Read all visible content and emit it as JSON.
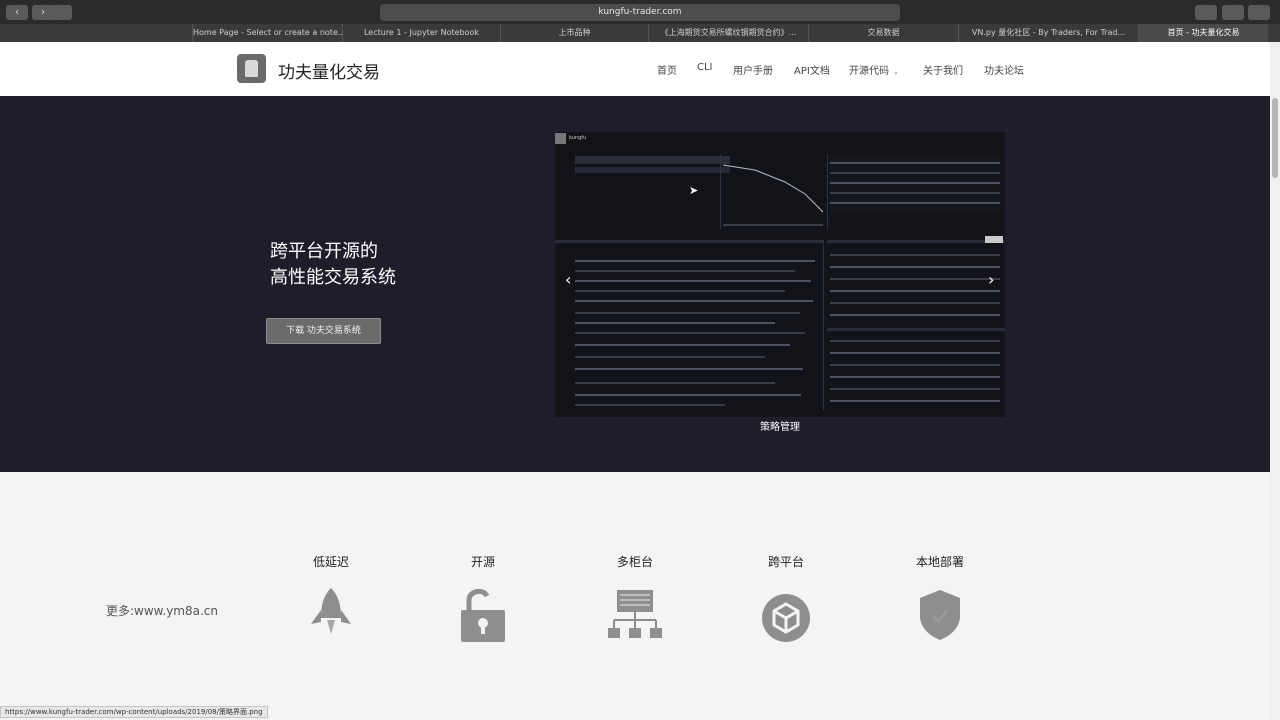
{
  "browser": {
    "url": "kungfu-trader.com",
    "tabs": [
      "Home Page - Select or create a note...",
      "Lecture 1 - Jupyter Notebook",
      "上市品种",
      "《上海期货交易所螺纹钢期货合约》...",
      "交易数据",
      "VN.py 量化社区 - By Traders, For Trad...",
      "首页 - 功夫量化交易"
    ]
  },
  "header": {
    "site_name": "功夫量化交易",
    "nav": [
      "首页",
      "CLI",
      "用户手册",
      "API文档",
      "开源代码",
      "关于我们",
      "功夫论坛"
    ]
  },
  "hero": {
    "headline_1": "跨平台开源的",
    "headline_2": "高性能交易系统",
    "download_button": "下载 功夫交易系统",
    "screenshot_title": "kungfu",
    "caption": "策略管理",
    "prev_arrow": "‹",
    "next_arrow": "›"
  },
  "features": {
    "watermark": "更多:www.ym8a.cn",
    "items": [
      {
        "label": "低延迟",
        "icon": "rocket-icon"
      },
      {
        "label": "开源",
        "icon": "unlocked-padlock-icon"
      },
      {
        "label": "多柜台",
        "icon": "hierarchy-icon"
      },
      {
        "label": "跨平台",
        "icon": "cube-icon"
      },
      {
        "label": "本地部署",
        "icon": "shield-icon"
      }
    ]
  },
  "status_bar": {
    "link": "https://www.kungfu-trader.com/wp-content/uploads/2019/08/策略界面.png"
  },
  "colors": {
    "hero_bg": "#1d1e2a",
    "header_bg": "#ffffff",
    "features_bg": "#f4f4f4",
    "icon_gray": "#8e8e8e"
  }
}
